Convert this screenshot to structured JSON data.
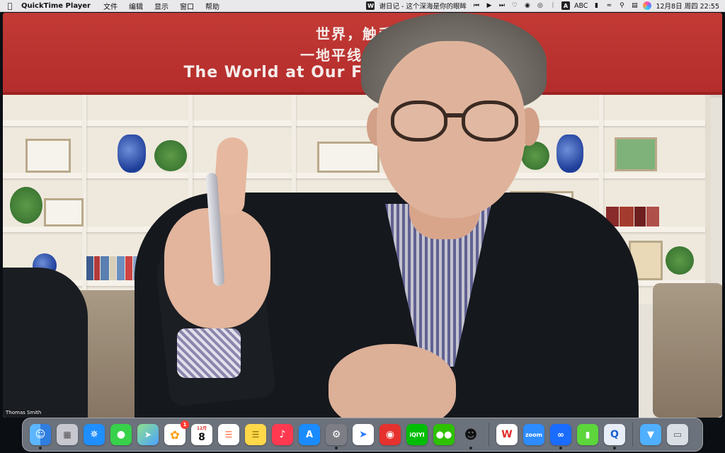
{
  "menubar": {
    "app_name": "QuickTime Player",
    "menus": [
      "文件",
      "编辑",
      "显示",
      "窗口",
      "帮助"
    ],
    "now_playing": "谢日记 - 这个深海是你的眼眸",
    "input_method": "ABC",
    "input_badge": "A",
    "datetime": "12月8日 周四  22:55"
  },
  "video": {
    "banner_line1": "世界，触手可",
    "banner_line2": "一地平线全球青年",
    "banner_line3": "The World at Our Fingert          ogram",
    "participant_name": "Thomas Smith"
  },
  "dock": {
    "photos_badge": "1",
    "calendar_month": "12月",
    "calendar_day": "8",
    "iqiyi_label": "iQIYI",
    "zoom_label": "zoom",
    "wps_label": "W",
    "items": [
      {
        "name": "finder",
        "color": "#2f8cff"
      },
      {
        "name": "launchpad",
        "color": "#c7c7cf"
      },
      {
        "name": "safari",
        "color": "#1f8fff"
      },
      {
        "name": "messages",
        "color": "#37d14a"
      },
      {
        "name": "maps",
        "color": "#5ccf6b"
      },
      {
        "name": "photos",
        "color": "#ffffff"
      },
      {
        "name": "calendar",
        "color": "#ffffff"
      },
      {
        "name": "reminders",
        "color": "#ffffff"
      },
      {
        "name": "notes",
        "color": "#ffd84a"
      },
      {
        "name": "music",
        "color": "#ff3a50"
      },
      {
        "name": "app-store",
        "color": "#1a8cff"
      },
      {
        "name": "system-preferences",
        "color": "#7d7d85"
      },
      {
        "name": "feishu",
        "color": "#2f7bff"
      },
      {
        "name": "netease-music",
        "color": "#e6322e"
      },
      {
        "name": "iqiyi",
        "color": "#00be06"
      },
      {
        "name": "wechat",
        "color": "#2dc100"
      },
      {
        "name": "qq",
        "color": "#ffffff"
      },
      {
        "name": "wps",
        "color": "#ffffff"
      },
      {
        "name": "zoom",
        "color": "#2d8cff"
      },
      {
        "name": "tencent-meeting",
        "color": "#1a6cff"
      },
      {
        "name": "iqiyi-sports",
        "color": "#5cd63b"
      },
      {
        "name": "quicktime",
        "color": "#e8eef7"
      },
      {
        "name": "downloads-folder",
        "color": "#4fb0ff"
      },
      {
        "name": "trash",
        "color": "#d9dde4"
      }
    ]
  }
}
